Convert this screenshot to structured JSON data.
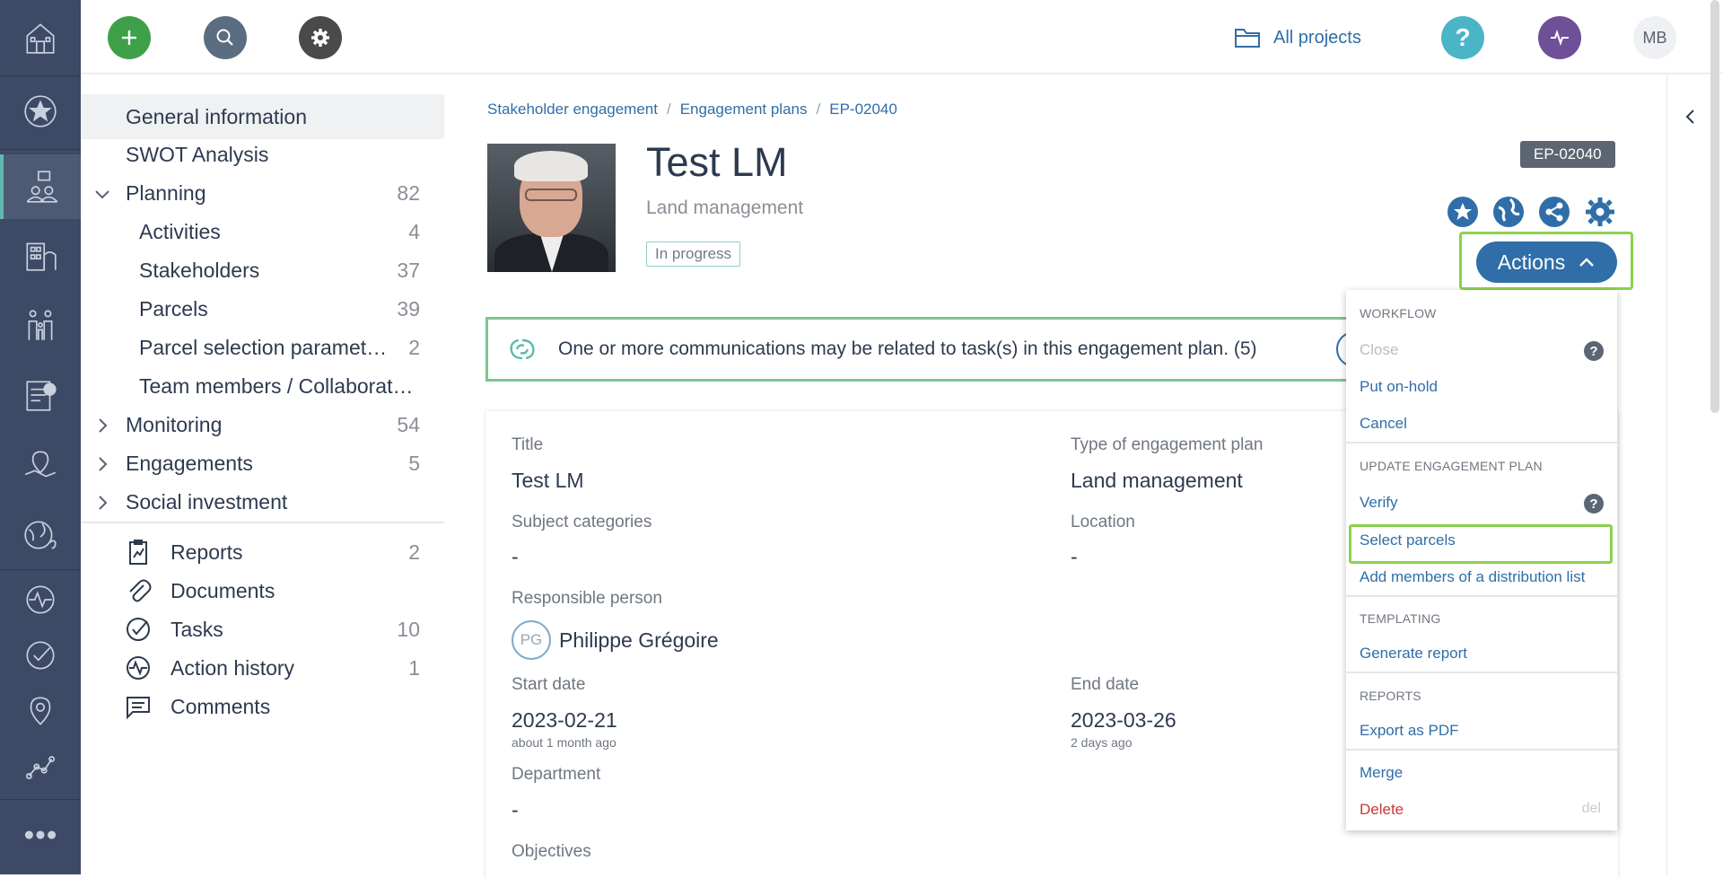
{
  "topbar": {
    "all_projects_label": "All projects",
    "user_initials": "MB"
  },
  "sidebar": {
    "items": [
      {
        "label": "General information",
        "count": ""
      },
      {
        "label": "SWOT Analysis",
        "count": ""
      },
      {
        "label": "Planning",
        "count": "82"
      },
      {
        "label": "Activities",
        "count": "4"
      },
      {
        "label": "Stakeholders",
        "count": "37"
      },
      {
        "label": "Parcels",
        "count": "39"
      },
      {
        "label": "Parcel selection paramet…",
        "count": "2"
      },
      {
        "label": "Team members / Collaborat…",
        "count": ""
      },
      {
        "label": "Monitoring",
        "count": "54"
      },
      {
        "label": "Engagements",
        "count": "5"
      },
      {
        "label": "Social investment",
        "count": ""
      },
      {
        "label": "Reports",
        "count": "2"
      },
      {
        "label": "Documents",
        "count": ""
      },
      {
        "label": "Tasks",
        "count": "10"
      },
      {
        "label": "Action history",
        "count": "1"
      },
      {
        "label": "Comments",
        "count": ""
      }
    ]
  },
  "breadcrumb": {
    "level1": "Stakeholder engagement",
    "level2": "Engagement plans",
    "level3": "EP-02040",
    "separator": "/"
  },
  "header": {
    "title": "Test LM",
    "subtitle": "Land management",
    "status": "In progress",
    "id": "EP-02040",
    "actions_label": "Actions"
  },
  "alert": {
    "text": "One or more communications may be related to task(s) in this engagement plan. (5)"
  },
  "details": {
    "title_label": "Title",
    "title_value": "Test LM",
    "type_label": "Type of engagement plan",
    "type_value": "Land management",
    "subject_label": "Subject categories",
    "subject_value": "-",
    "location_label": "Location",
    "location_value": "-",
    "responsible_label": "Responsible person",
    "responsible_initials": "PG",
    "responsible_name": "Philippe Grégoire",
    "start_label": "Start date",
    "start_value": "2023-02-21",
    "start_relative": "about 1 month ago",
    "end_label": "End date",
    "end_value": "2023-03-26",
    "end_relative": "2 days ago",
    "department_label": "Department",
    "department_value": "-",
    "objectives_label": "Objectives"
  },
  "dropdown": {
    "workflow_header": "WORKFLOW",
    "close": "Close",
    "put_on_hold": "Put on-hold",
    "cancel": "Cancel",
    "update_header": "UPDATE ENGAGEMENT PLAN",
    "verify": "Verify",
    "select_parcels": "Select parcels",
    "add_members": "Add members of a distribution list",
    "templating_header": "TEMPLATING",
    "generate_report": "Generate report",
    "reports_header": "REPORTS",
    "export_pdf": "Export as PDF",
    "merge": "Merge",
    "delete": "Delete",
    "delete_shortcut": "del",
    "help_glyph": "?"
  },
  "colors": {
    "rail": "#3c4a66",
    "accent_blue": "#2f6ea8",
    "highlight_green": "#8cd14e",
    "add_green": "#3fa04a"
  }
}
